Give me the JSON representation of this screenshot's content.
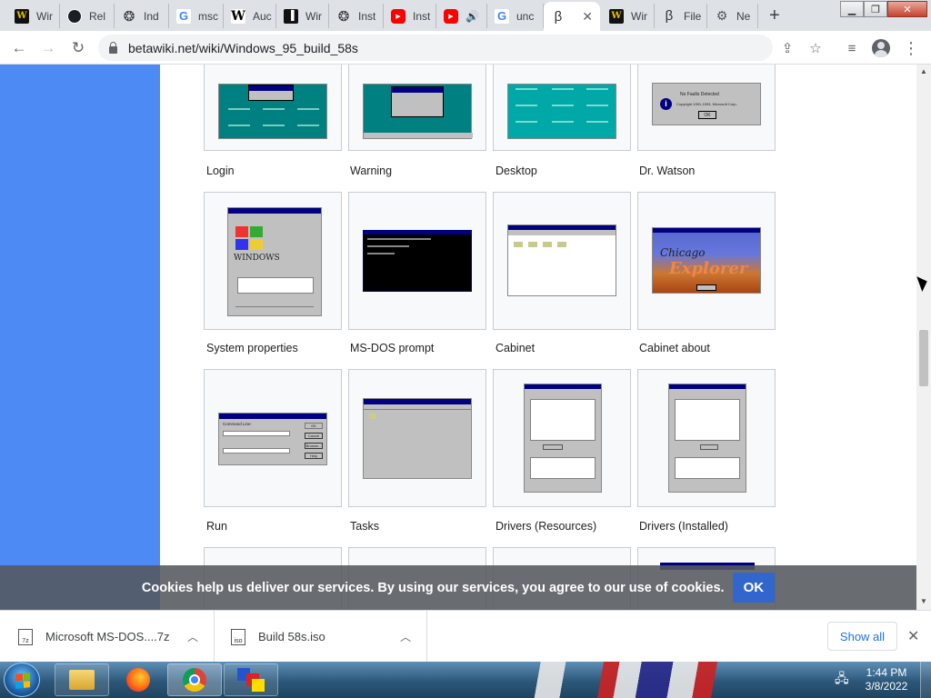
{
  "browser": {
    "tabs": [
      {
        "favicon": "W",
        "favicon_kind": "wiki-w",
        "title": "Wir"
      },
      {
        "favicon": "",
        "favicon_kind": "github",
        "title": "Rel"
      },
      {
        "favicon": "❂",
        "favicon_kind": "betawiki",
        "title": "Ind"
      },
      {
        "favicon": "G",
        "favicon_kind": "google",
        "title": "msc"
      },
      {
        "favicon": "W",
        "favicon_kind": "wikipedia",
        "title": "Auc"
      },
      {
        "favicon": "▐",
        "favicon_kind": "museum",
        "title": "Wir"
      },
      {
        "favicon": "❂",
        "favicon_kind": "betawiki",
        "title": "Inst"
      },
      {
        "favicon": "▶",
        "favicon_kind": "youtube",
        "title": "Inst"
      },
      {
        "favicon": "▶",
        "favicon_kind": "youtube",
        "title": "🔊"
      },
      {
        "favicon": "G",
        "favicon_kind": "google",
        "title": "unc"
      },
      {
        "favicon": "β",
        "favicon_kind": "betawiki",
        "title": ""
      },
      {
        "favicon": "W",
        "favicon_kind": "wiki-w",
        "title": "Wir"
      },
      {
        "favicon": "β",
        "favicon_kind": "betawiki",
        "title": "File"
      },
      {
        "favicon": "⚙",
        "favicon_kind": "network",
        "title": "Ne"
      }
    ],
    "new_tab": "+",
    "url": "betawiki.net/wiki/Windows_95_build_58s"
  },
  "gallery": {
    "rows": [
      [
        "Login",
        "Warning",
        "Desktop",
        "Dr. Watson"
      ],
      [
        "System properties",
        "MS-DOS prompt",
        "Cabinet",
        "Cabinet about"
      ],
      [
        "Run",
        "Tasks",
        "Drivers (Resources)",
        "Drivers (Installed)"
      ]
    ],
    "drwatson_title": "No Faults Detected",
    "drwatson_copyright": "Copyright 1991-1993, Microsoft Corp.",
    "drwatson_ok": "OK",
    "sysprop_logo": "WINDOWS",
    "explorer_logo_1": "Chicago",
    "explorer_logo_2": "Explorer",
    "run_label": "Command Line:",
    "run_buttons": [
      "OK",
      "Cancel",
      "Browse...",
      "Help"
    ]
  },
  "cookie": {
    "text": "Cookies help us deliver our services. By using our services, you agree to our use of cookies.",
    "ok": "OK"
  },
  "downloads": {
    "items": [
      {
        "name": "Microsoft MS-DOS....7z",
        "icon": "7z"
      },
      {
        "name": "Build 58s.iso",
        "icon": "iso"
      }
    ],
    "show_all": "Show all"
  },
  "taskbar": {
    "time": "1:44 PM",
    "date": "3/8/2022"
  }
}
